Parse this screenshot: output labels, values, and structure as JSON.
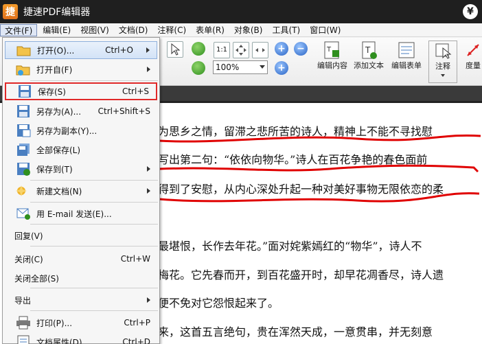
{
  "app": {
    "logo_letter": "捷",
    "title": "捷速PDF编辑器",
    "currency_symbol": "¥"
  },
  "menubar": [
    "文件(F)",
    "编辑(E)",
    "视图(V)",
    "文档(D)",
    "注释(C)",
    "表单(R)",
    "对象(B)",
    "工具(T)",
    "窗口(W)"
  ],
  "toolbar": {
    "zoom_value": "100%",
    "fit_label": "1:1",
    "buttons": [
      "编辑内容",
      "添加文本",
      "编辑表单",
      "注释",
      "度量"
    ]
  },
  "file_menu": {
    "items": [
      {
        "label": "打开(O)...",
        "shortcut": "Ctrl+O",
        "submenu": true,
        "icon": "folder-open-icon"
      },
      {
        "label": "打开自(F)",
        "shortcut": "",
        "submenu": true,
        "icon": "folder-web-icon"
      },
      {
        "label": "保存(S)",
        "shortcut": "Ctrl+S",
        "submenu": false,
        "icon": "save-icon"
      },
      {
        "label": "另存为(A)...",
        "shortcut": "Ctrl+Shift+S",
        "submenu": false,
        "icon": "save-as-icon"
      },
      {
        "label": "另存为副本(Y)...",
        "shortcut": "",
        "submenu": false,
        "icon": "save-copy-icon"
      },
      {
        "label": "全部保存(L)",
        "shortcut": "",
        "submenu": false,
        "icon": "save-all-icon"
      },
      {
        "label": "保存到(T)",
        "shortcut": "",
        "submenu": true,
        "icon": "save-to-icon"
      },
      {
        "label": "新建文档(N)",
        "shortcut": "",
        "submenu": true,
        "icon": "new-document-icon"
      },
      {
        "label": "用 E-mail 发送(E)...",
        "shortcut": "",
        "submenu": false,
        "icon": "email-icon"
      },
      {
        "label": "回复(V)",
        "shortcut": "",
        "submenu": false,
        "icon": ""
      },
      {
        "label": "关闭(C)",
        "shortcut": "Ctrl+W",
        "submenu": false,
        "icon": ""
      },
      {
        "label": "关闭全部(S)",
        "shortcut": "",
        "submenu": false,
        "icon": ""
      },
      {
        "label": "导出",
        "shortcut": "",
        "submenu": true,
        "icon": ""
      },
      {
        "label": "打印(P)...",
        "shortcut": "Ctrl+P",
        "submenu": false,
        "icon": "printer-icon"
      },
      {
        "label": "文档属性(D)...",
        "shortcut": "Ctrl+D",
        "submenu": false,
        "icon": "properties-icon"
      }
    ]
  },
  "document": {
    "lines": [
      "为思乡之情，留滞之悲所苦的诗人，精神上不能不寻找慰",
      "写出第二句：“依依向物华。”诗人在百花争艳的春色面前",
      "得到了安慰，从内心深处升起一种对美好事物无限依恋的柔",
      "最堪恨，长作去年花。”面对姹紫嫣红的“物华”，诗人不",
      "梅花。它先春而开，到百花盛开时，却早花凋香尽，诗人遗",
      "便不免对它怨恨起来了。",
      "来，这首五言绝句，贵在浑然天成，一意贯串，并无刻意"
    ],
    "underline_color": "#e00000"
  }
}
